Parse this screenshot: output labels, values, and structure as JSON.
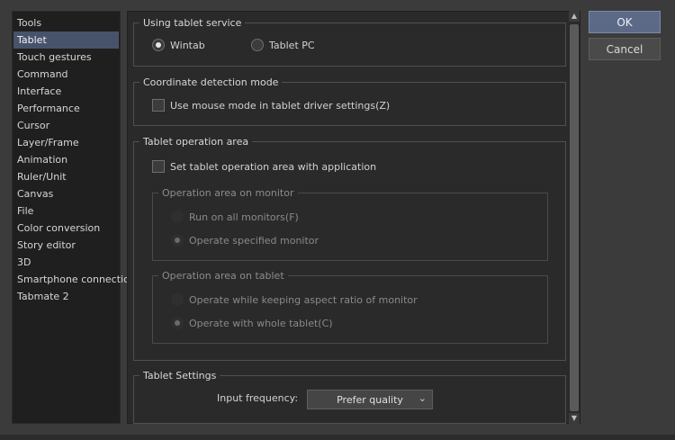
{
  "sidebar": {
    "items": [
      {
        "label": "Tools",
        "active": false
      },
      {
        "label": "Tablet",
        "active": true
      },
      {
        "label": "Touch gestures",
        "active": false
      },
      {
        "label": "Command",
        "active": false
      },
      {
        "label": "Interface",
        "active": false
      },
      {
        "label": "Performance",
        "active": false
      },
      {
        "label": "Cursor",
        "active": false
      },
      {
        "label": "Layer/Frame",
        "active": false
      },
      {
        "label": "Animation",
        "active": false
      },
      {
        "label": "Ruler/Unit",
        "active": false
      },
      {
        "label": "Canvas",
        "active": false
      },
      {
        "label": "File",
        "active": false
      },
      {
        "label": "Color conversion",
        "active": false
      },
      {
        "label": "Story editor",
        "active": false
      },
      {
        "label": "3D",
        "active": false
      },
      {
        "label": "Smartphone connection",
        "active": false
      },
      {
        "label": "Tabmate 2",
        "active": false
      }
    ]
  },
  "tablet_service": {
    "title": "Using tablet service",
    "wintab": "Wintab",
    "tablet_pc": "Tablet PC",
    "selected": "wintab"
  },
  "coordinate": {
    "title": "Coordinate detection mode",
    "mouse_mode": "Use mouse mode in tablet driver settings(Z)",
    "mouse_mode_checked": false
  },
  "operation_area": {
    "title": "Tablet operation area",
    "set_with_app": "Set tablet operation area with application",
    "set_with_app_checked": false,
    "monitor": {
      "title": "Operation area on monitor",
      "all_monitors": "Run on all monitors(F)",
      "specified": "Operate specified monitor"
    },
    "tablet": {
      "title": "Operation area on tablet",
      "keep_aspect": "Operate while keeping aspect ratio of monitor",
      "whole": "Operate with whole tablet(C)"
    }
  },
  "settings": {
    "title": "Tablet Settings",
    "input_frequency_label": "Input frequency:",
    "input_frequency_value": "Prefer quality"
  },
  "buttons": {
    "ok": "OK",
    "cancel": "Cancel"
  },
  "icons": {
    "dropdown": "chevron-down-icon",
    "scroll_up": "scroll-up-arrow-icon",
    "scroll_down": "scroll-down-arrow-icon"
  },
  "colors": {
    "selection": "#47536a",
    "ok_button": "#5c6a87"
  }
}
